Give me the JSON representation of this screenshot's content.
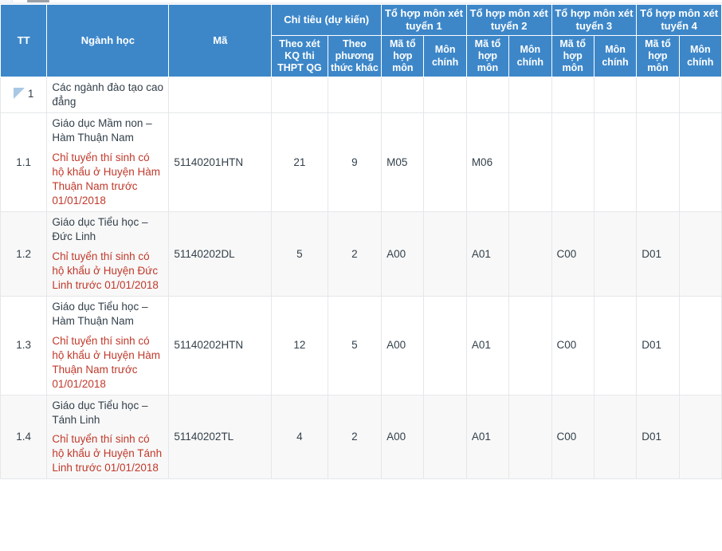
{
  "table": {
    "header": {
      "tt": "TT",
      "nganh_hoc": "Ngành học",
      "ma": "Mã",
      "chi_tieu": "Chỉ tiêu (dự kiến)",
      "chi_tieu_sub": [
        "Theo xét KQ thi THPT QG",
        "Theo phương thức khác"
      ],
      "groups": [
        "Tổ hợp môn xét tuyển 1",
        "Tổ hợp môn xét tuyển 2",
        "Tổ hợp môn xét tuyển 3",
        "Tổ hợp môn xét tuyển 4"
      ],
      "group_sub": [
        "Mã tổ hợp môn",
        "Môn chính"
      ]
    },
    "colors": {
      "header_bg": "#3d87c9",
      "header_text": "#ffffff",
      "note_text": "#c0392b",
      "body_text": "#33404b",
      "stripe_bg": "#f8f8f8",
      "grid_line": "#e4e7ea",
      "collapse_icon": "#a8c8e4"
    },
    "rows": [
      {
        "tt": "1",
        "has_collapse_icon": true,
        "collapse_icon": "collapse-triangle-icon",
        "name": "Các ngành đào tạo cao đẳng",
        "note": "",
        "code": "",
        "q_thpt": "",
        "q_khac": "",
        "g1_code": "",
        "g1_main": "",
        "g2_code": "",
        "g2_main": "",
        "g3_code": "",
        "g3_main": "",
        "g4_code": "",
        "g4_main": "",
        "stripe": false
      },
      {
        "tt": "1.1",
        "has_collapse_icon": false,
        "name": "Giáo dục Mầm non – Hàm Thuận Nam",
        "note": "Chỉ tuyển thí sinh có hộ khẩu ở Huyện Hàm Thuận Nam trước 01/01/2018",
        "code": "51140201HTN",
        "q_thpt": "21",
        "q_khac": "9",
        "g1_code": "M05",
        "g1_main": "",
        "g2_code": "M06",
        "g2_main": "",
        "g3_code": "",
        "g3_main": "",
        "g4_code": "",
        "g4_main": "",
        "stripe": false
      },
      {
        "tt": "1.2",
        "has_collapse_icon": false,
        "name": "Giáo dục Tiểu học – Đức Linh",
        "note": "Chỉ tuyển thí sinh có hộ khẩu ở Huyện Đức Linh trước 01/01/2018",
        "code": "51140202DL",
        "q_thpt": "5",
        "q_khac": "2",
        "g1_code": "A00",
        "g1_main": "",
        "g2_code": "A01",
        "g2_main": "",
        "g3_code": "C00",
        "g3_main": "",
        "g4_code": "D01",
        "g4_main": "",
        "stripe": true
      },
      {
        "tt": "1.3",
        "has_collapse_icon": false,
        "name": "Giáo dục Tiểu học – Hàm Thuận Nam",
        "note": "Chỉ tuyển thí sinh có hộ khẩu ở Huyện Hàm Thuận Nam trước 01/01/2018",
        "code": "51140202HTN",
        "q_thpt": "12",
        "q_khac": "5",
        "g1_code": "A00",
        "g1_main": "",
        "g2_code": "A01",
        "g2_main": "",
        "g3_code": "C00",
        "g3_main": "",
        "g4_code": "D01",
        "g4_main": "",
        "stripe": false
      },
      {
        "tt": "1.4",
        "has_collapse_icon": false,
        "name": "Giáo dục Tiểu học – Tánh Linh",
        "note": "Chỉ tuyển thí sinh có hộ khẩu ở Huyện Tánh Linh trước 01/01/2018",
        "code": "51140202TL",
        "q_thpt": "4",
        "q_khac": "2",
        "g1_code": "A00",
        "g1_main": "",
        "g2_code": "A01",
        "g2_main": "",
        "g3_code": "C00",
        "g3_main": "",
        "g4_code": "D01",
        "g4_main": "",
        "stripe": true
      }
    ]
  }
}
